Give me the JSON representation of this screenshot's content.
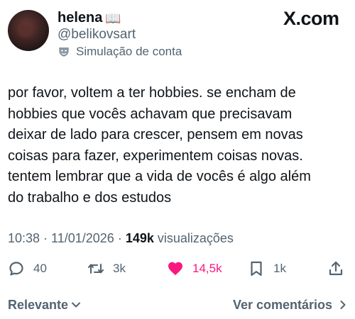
{
  "author": {
    "display_name": "helena",
    "name_emoji": "📖",
    "handle": "@belikovsart",
    "account_label": "Simulação de conta",
    "label_icon": "mask-icon"
  },
  "brand": {
    "logo": "X.com"
  },
  "tweet": {
    "lines": [
      "por favor, voltem a ter hobbies. se encham de",
      "hobbies que vocês achavam que precisavam",
      "deixar de lado para crescer, pensem em novas",
      "coisas para fazer, experimentem coisas novas.",
      "tentem lembrar que a vida de vocês é algo além",
      "do trabalho e dos estudos"
    ]
  },
  "meta": {
    "time": "10:38",
    "separator": " · ",
    "date": "11/01/2026",
    "views_count": "149k",
    "views_label": " visualizações"
  },
  "actions": {
    "replies": "40",
    "reposts": "3k",
    "likes": "14,5k",
    "bookmarks": "1k"
  },
  "footer": {
    "sort_label": "Relevante",
    "comments_link": "Ver comentários"
  },
  "colors": {
    "text": "#0f1419",
    "secondary": "#536471",
    "like": "#f91880"
  }
}
